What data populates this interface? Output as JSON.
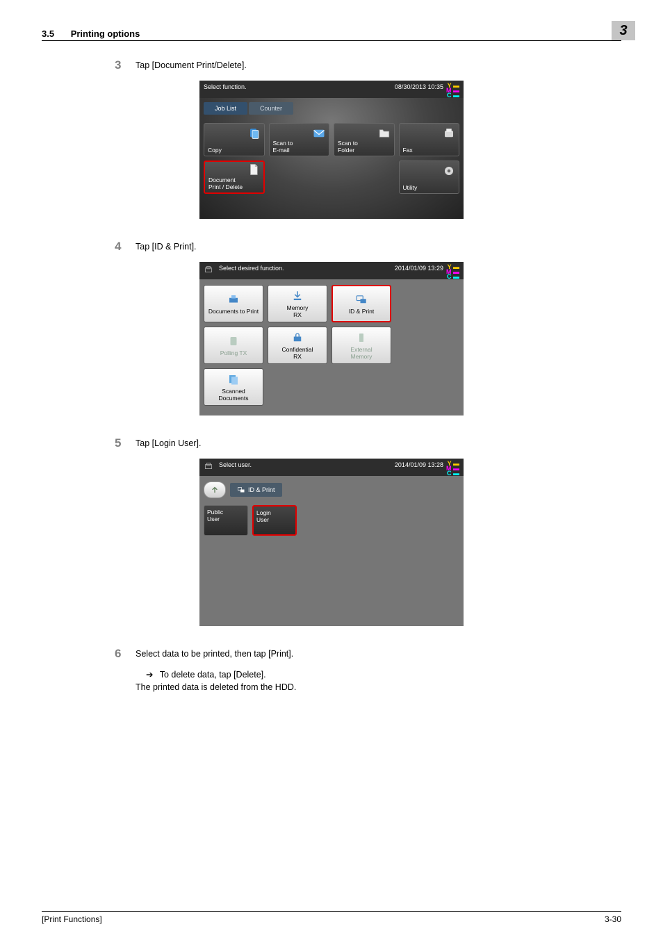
{
  "header": {
    "section_num": "3.5",
    "section_title": "Printing options",
    "chapter": "3"
  },
  "steps": {
    "s3": {
      "num": "3",
      "text": "Tap [Document Print/Delete]."
    },
    "s4": {
      "num": "4",
      "text": "Tap [ID & Print]."
    },
    "s5": {
      "num": "5",
      "text": "Tap [Login User]."
    },
    "s6": {
      "num": "6",
      "text": "Select data to be printed, then tap [Print].",
      "detail1": "To delete data, tap [Delete].",
      "detail2": "The printed data is deleted from the HDD."
    }
  },
  "shot1": {
    "prompt": "Select function.",
    "timestamp": "08/30/2013 10:35",
    "tab1": "Job List",
    "tab2": "Counter",
    "tiles": {
      "copy": "Copy",
      "scan_email": "Scan to\nE-mail",
      "scan_folder": "Scan to\nFolder",
      "fax": "Fax",
      "doc_pd": "Document\nPrint / Delete",
      "utility": "Utility"
    }
  },
  "shot2": {
    "prompt": "Select desired function.",
    "timestamp": "2014/01/09 13:29",
    "tiles": {
      "docs_print": "Documents to Print",
      "memory_rx": "Memory\nRX",
      "id_print": "ID & Print",
      "polling_tx": "Polling TX",
      "conf_rx": "Confidential\nRX",
      "ext_mem": "External\nMemory",
      "scanned": "Scanned\nDocuments"
    }
  },
  "shot3": {
    "prompt": "Select user.",
    "timestamp": "2014/01/09 13:28",
    "crumb": "ID & Print",
    "users": {
      "public": "Public\nUser",
      "login": "Login\nUser"
    }
  },
  "footer": {
    "left": "[Print Functions]",
    "right": "3-30"
  }
}
